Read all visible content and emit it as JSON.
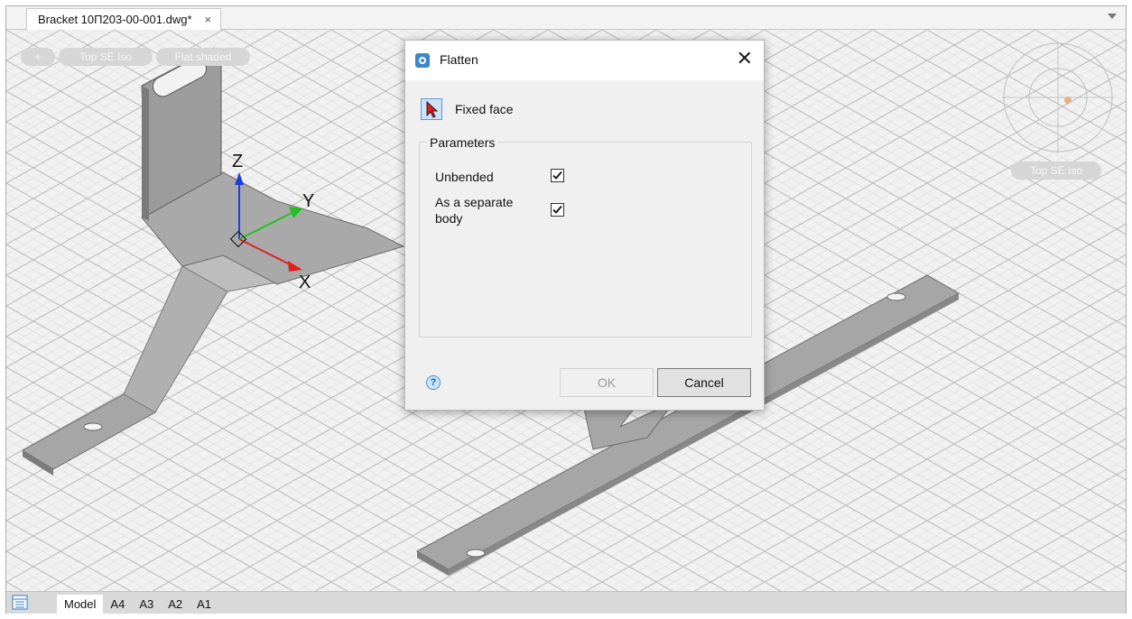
{
  "document_tab": {
    "title": "Bracket 10П203-00-001.dwg*",
    "close_glyph": "×"
  },
  "viewport": {
    "chips": [
      "+",
      "Top SE Iso",
      "Flat shaded"
    ],
    "viewcube_label": "Top SE Iso",
    "axes": {
      "x": "X",
      "y": "Y",
      "z": "Z"
    }
  },
  "dialog": {
    "title": "Flatten",
    "close_glyph": "✕",
    "fixed_face_label": "Fixed face",
    "parameters_group": "Parameters",
    "unbended_label": "Unbended",
    "unbended_checked": true,
    "separate_body_label_line1": "As a separate",
    "separate_body_label_line2": "body",
    "separate_body_checked": true,
    "help_glyph": "?",
    "ok_label": "OK",
    "ok_enabled": false,
    "cancel_label": "Cancel"
  },
  "status_bar": {
    "layout_tabs": [
      "Model",
      "A4",
      "A3",
      "A2",
      "A1"
    ],
    "active_tab": "Model"
  },
  "colors": {
    "axis_x": "#e02020",
    "axis_y": "#22c022",
    "axis_z": "#1b3ee0",
    "accent": "#3a86c8",
    "part_fill": "#a3a3a3"
  }
}
